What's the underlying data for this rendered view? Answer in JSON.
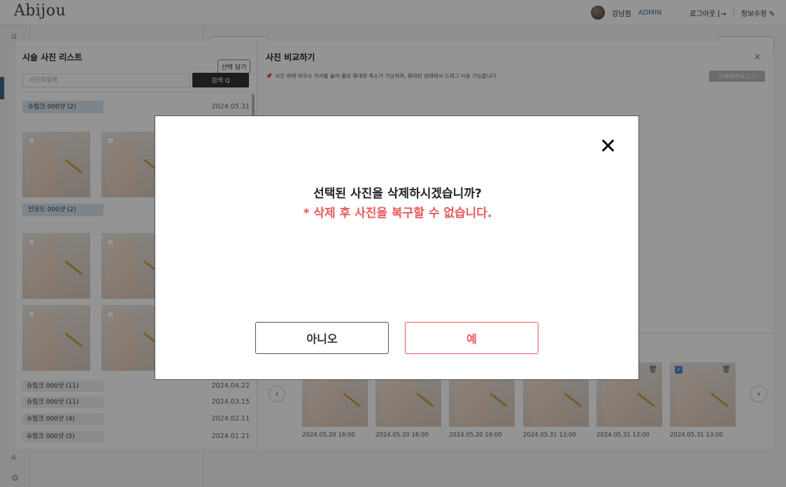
{
  "app": {
    "logo": "Abijou"
  },
  "header": {
    "branch": "강남점",
    "role": "ADMIN",
    "logout_label": "로그아웃 [→",
    "edit_info_label": "정보수정 ✎"
  },
  "rail": {
    "home_icon": "⌂",
    "user_icon": "ጸ",
    "settings_icon": "⚙"
  },
  "list_panel": {
    "title": "시술 사진 리스트",
    "select_button": "선택 담기",
    "search_placeholder": "사진파일명",
    "search_button": "검색 Q",
    "groups": [
      {
        "label": "슈링크 000샷 (2)",
        "date": "2024.05.31"
      },
      {
        "label": "인모드 000샷 (2)",
        "date": ""
      }
    ],
    "rows": [
      {
        "label": "슈링크 000샷 (11)",
        "date": "2024.04.22"
      },
      {
        "label": "슈링크 000샷 (11)",
        "date": "2024.03.15"
      },
      {
        "label": "슈링크 000샷 (4)",
        "date": "2024.02.11"
      },
      {
        "label": "슈링크 000샷 (5)",
        "date": "2024.01.21"
      }
    ]
  },
  "compare_panel": {
    "title": "사진 비교하기",
    "close_icon": "×",
    "note": "사진 위에 마우스 커서를 올려 휠로 확대와 축소가 가능하며, 확대된 상태에서 드래그 이동 가능합니다.",
    "fullscreen_button": "전체화면보기 ⤢",
    "prev_icon": "‹",
    "next_icon": "›",
    "strip": [
      {
        "date": "2024.05.20 16:00"
      },
      {
        "date": "2024.05.20 16:00"
      },
      {
        "date": "2024.05.20 16:00"
      },
      {
        "date": "2024.05.31 13:00"
      },
      {
        "date": "2024.05.31 13:00"
      },
      {
        "date": "2024.05.31 13:00"
      }
    ]
  },
  "dialog": {
    "message": "선택된 사진을 삭제하시겠습니까?",
    "warning": "* 삭제 후 사진을 복구할 수 없습니다.",
    "no_button": "아니오",
    "yes_button": "예"
  },
  "colors": {
    "accent_blue": "#3e6785",
    "danger": "#e85a5a",
    "category_bg": "#d8e6f0"
  }
}
